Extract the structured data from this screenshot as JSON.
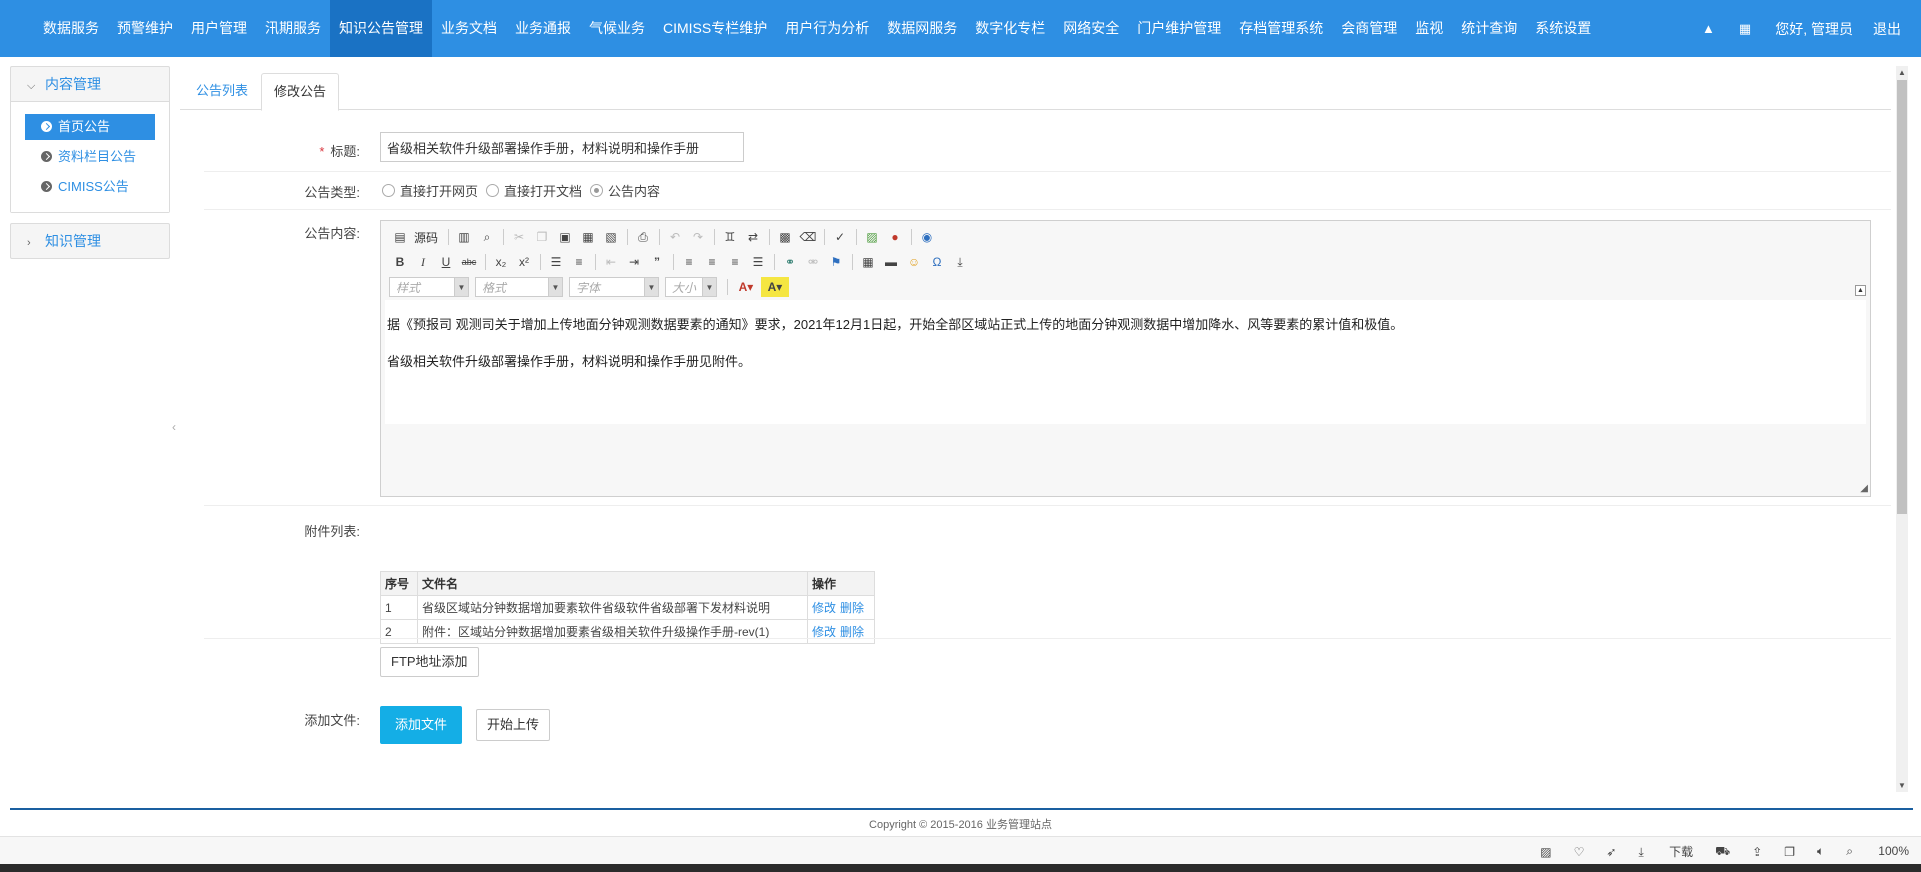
{
  "topnav": {
    "items": [
      "数据服务",
      "预警维护",
      "用户管理",
      "汛期服务",
      "知识公告管理",
      "业务文档",
      "业务通报",
      "气候业务",
      "CIMISS专栏维护",
      "用户行为分析",
      "数据网服务",
      "数字化专栏",
      "网络安全",
      "门户维护管理",
      "存档管理系统",
      "会商管理",
      "监视",
      "统计查询",
      "系统设置"
    ],
    "active_index": 4,
    "greeting": "您好, 管理员",
    "logout": "退出",
    "up_icon": "▲",
    "grid_icon": "▦"
  },
  "sidebar": {
    "content_mgmt": {
      "label": "内容管理",
      "chevron": "⌄",
      "items": [
        "首页公告",
        "资料栏目公告",
        "CIMISS公告"
      ]
    },
    "knowledge_mgmt": {
      "label": "知识管理",
      "chevron": "›"
    }
  },
  "tabs": [
    "公告列表",
    "修改公告"
  ],
  "form": {
    "title_label": "标题:",
    "title_value": "省级相关软件升级部署操作手册，材料说明和操作手册",
    "type_label": "公告类型:",
    "type_options": [
      "直接打开网页",
      "直接打开文档",
      "公告内容"
    ],
    "type_selected": 2,
    "content_label": "公告内容:",
    "attachments_label": "附件列表:",
    "add_file_label": "添加文件:"
  },
  "editor": {
    "source_label": "源码",
    "style_combo": "样式",
    "format_combo": "格式",
    "font_combo": "字体",
    "size_combo": "大小",
    "paragraphs": [
      "据《预报司 观测司关于增加上传地面分钟观测数据要素的通知》要求，2021年12月1日起，开始全部区域站正式上传的地面分钟观测数据中增加降水、风等要素的累计值和极值。",
      "省级相关软件升级部署操作手册，材料说明和操作手册见附件。"
    ]
  },
  "attachments": {
    "headers": [
      "序号",
      "文件名",
      "操作"
    ],
    "rows": [
      {
        "no": "1",
        "name": "省级区域站分钟数据增加要素软件省级软件省级部署下发材料说明",
        "edit": "修改",
        "delete": "删除"
      },
      {
        "no": "2",
        "name": "附件：区域站分钟数据增加要素省级相关软件升级操作手册-rev(1)",
        "edit": "修改",
        "delete": "删除"
      }
    ]
  },
  "buttons": {
    "ftp_add": "FTP地址添加",
    "add_file": "添加文件",
    "start_upload": "开始上传"
  },
  "footer": {
    "copyright": "Copyright © 2015-2016 业务管理站点"
  },
  "statusbar": {
    "download": "下载",
    "zoom": "100%"
  },
  "colors": {
    "nav_bg": "#2e8fe3",
    "nav_active": "#1a72c4",
    "link": "#2e8fe3",
    "primary_button": "#14aee6"
  }
}
